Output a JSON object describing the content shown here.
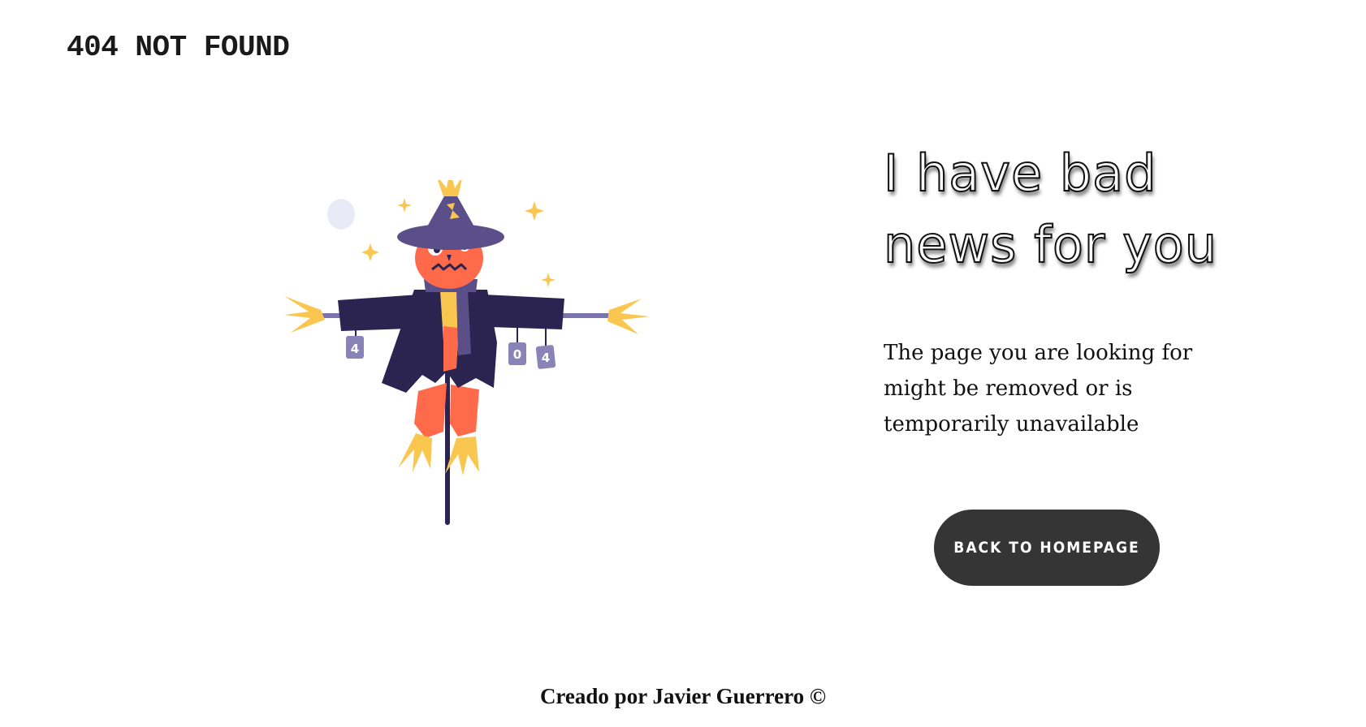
{
  "header": {
    "site_title": "404 NOT FOUND"
  },
  "illustration": {
    "subject": "scarecrow-404",
    "cans": [
      "4",
      "0",
      "4"
    ],
    "colors": {
      "hat": "#5b4f8a",
      "coat": "#2b2450",
      "face": "#ff6b4a",
      "straw": "#f9c74f",
      "moon": "#e8eaf6",
      "can": "#8a83b8"
    }
  },
  "main": {
    "headline_line1": "I have bad",
    "headline_line2": "news for you",
    "description": "The page you are looking for might be removed or is temporarily unavailable",
    "button_label": "BACK TO HOMEPAGE"
  },
  "footer": {
    "credit": "Creado por Javier Guerrero ©"
  },
  "colors": {
    "background": "#ffffff",
    "button_bg": "#353535",
    "button_text": "#ffffff",
    "text": "#111111"
  }
}
